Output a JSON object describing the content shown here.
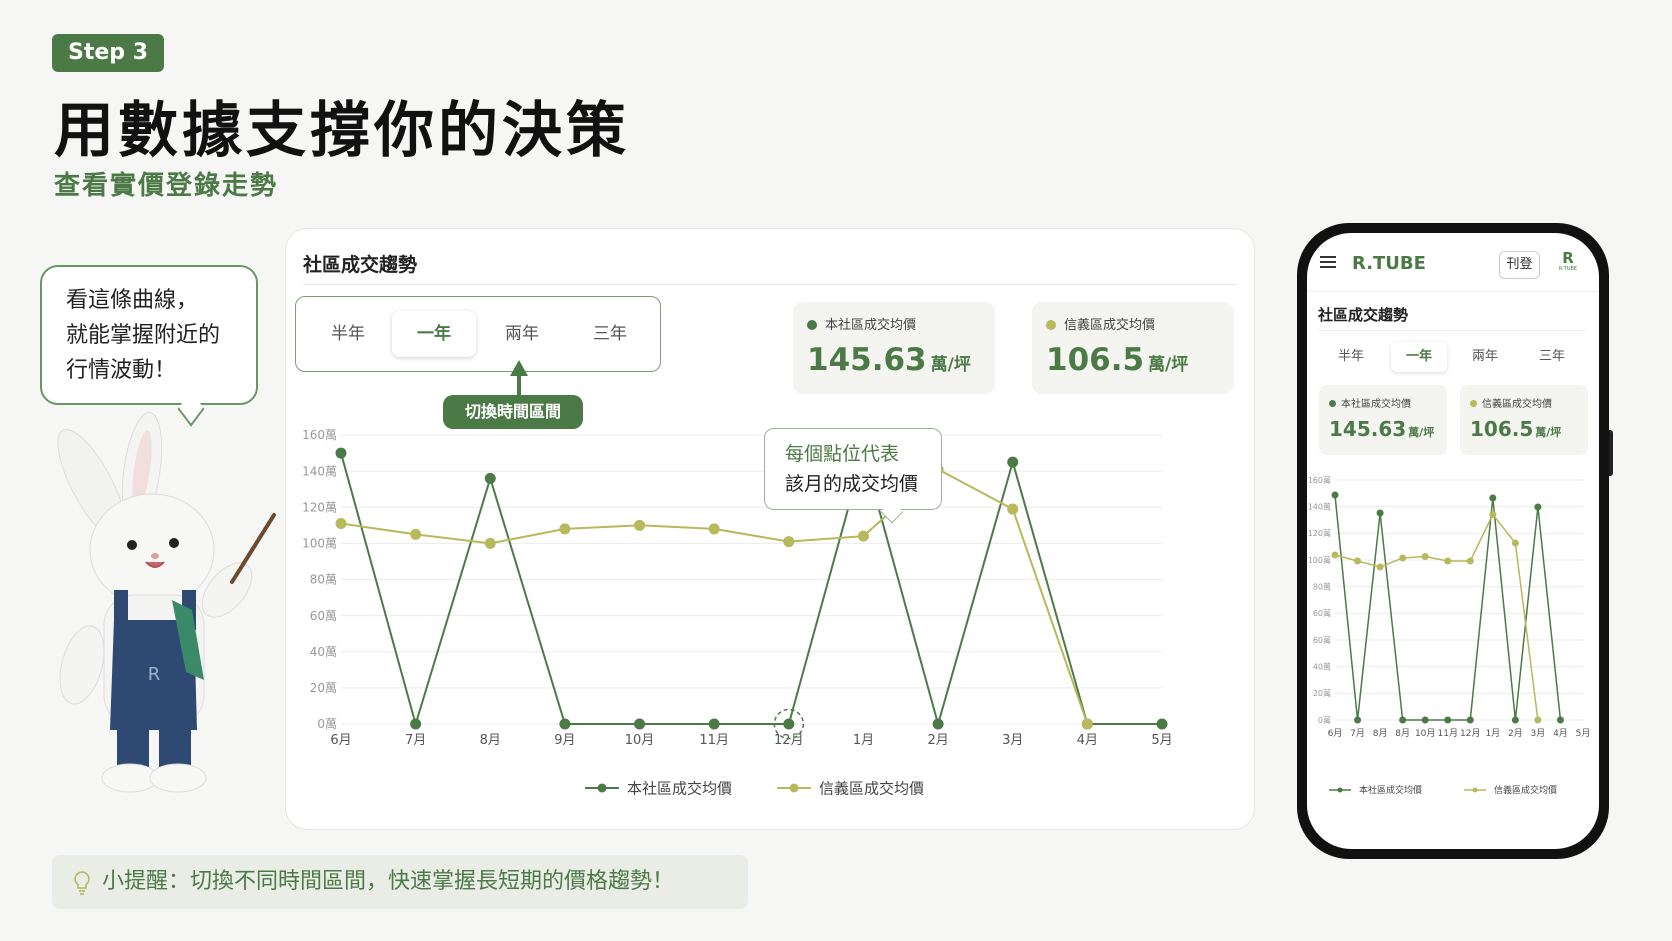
{
  "header": {
    "step": "Step 3",
    "title": "用數據支撐你的決策",
    "subtitle": "查看實價登錄走勢"
  },
  "speech": {
    "lines": [
      "看這條曲線，",
      "就能掌握附近的",
      "行情波動！"
    ]
  },
  "card": {
    "title": "社區成交趨勢",
    "ranges": [
      "半年",
      "一年",
      "兩年",
      "三年"
    ],
    "active_range": "一年",
    "range_tip": "切換時間區間",
    "stats": [
      {
        "label": "本社區成交均價",
        "value": "145.63",
        "unit": "萬/坪",
        "color": "#4c7a47"
      },
      {
        "label": "信義區成交均價",
        "value": "106.5",
        "unit": "萬/坪",
        "color": "#b8b85c"
      }
    ],
    "point_tip": [
      "每個點位代表",
      "該月的成交均價"
    ]
  },
  "hint": {
    "text": "小提醒：切換不同時間區間，快速掌握長短期的價格趨勢！"
  },
  "phone": {
    "brand": "R.TUBE",
    "post_button": "刊登",
    "logo_letter": "R",
    "logo_text": "R.TUBE",
    "title": "社區成交趨勢",
    "ranges": [
      "半年",
      "一年",
      "兩年",
      "三年"
    ],
    "stats": [
      {
        "label": "本社區成交均價",
        "value": "145.63",
        "unit": "萬/坪"
      },
      {
        "label": "信義區成交均價",
        "value": "106.5",
        "unit": "萬/坪"
      }
    ]
  },
  "colors": {
    "accent": "#4c7a47",
    "series_community": "#4c7a47",
    "series_district": "#b8b85c"
  },
  "icons": [
    "menu-icon",
    "lightbulb-icon",
    "legend-dot-icon"
  ],
  "chart_data": [
    {
      "type": "line",
      "title": "社區成交趨勢",
      "categories": [
        "6月",
        "7月",
        "8月",
        "9月",
        "10月",
        "11月",
        "12月",
        "1月",
        "2月",
        "3月",
        "4月",
        "5月"
      ],
      "ylim": [
        0,
        160
      ],
      "yticks": [
        "0萬",
        "20萬",
        "40萬",
        "60萬",
        "80萬",
        "100萬",
        "120萬",
        "140萬",
        "160萬"
      ],
      "grid": true,
      "legend": "bottom",
      "series": [
        {
          "name": "本社區成交均價",
          "color": "#4c7a47",
          "values": [
            150,
            0,
            136,
            0,
            0,
            0,
            0,
            150,
            0,
            145,
            0,
            0
          ]
        },
        {
          "name": "信義區成交均價",
          "color": "#b8b85c",
          "values": [
            111,
            105,
            100,
            108,
            110,
            108,
            101,
            104,
            141,
            119,
            0,
            null
          ]
        }
      ],
      "highlight_index": 6
    },
    {
      "type": "line",
      "categories": [
        "6月",
        "7月",
        "8月",
        "8月",
        "10月",
        "11月",
        "12月",
        "1月",
        "2月",
        "3月",
        "4月",
        "5月"
      ],
      "ylim": [
        0,
        160
      ],
      "yticks": [
        "0萬",
        "20萬",
        "40萬",
        "60萬",
        "60萬",
        "80萬",
        "100萬",
        "120萬",
        "140萬",
        "160萬"
      ],
      "grid": true,
      "legend": "bottom",
      "series": [
        {
          "name": "本社區成交均價",
          "color": "#4c7a47",
          "values": [
            150,
            0,
            138,
            0,
            0,
            0,
            0,
            148,
            0,
            142,
            0,
            null
          ]
        },
        {
          "name": "信義區成交均價",
          "color": "#b8b85c",
          "values": [
            110,
            106,
            102,
            108,
            109,
            106,
            106,
            137,
            118,
            0,
            null,
            null
          ]
        }
      ]
    }
  ]
}
